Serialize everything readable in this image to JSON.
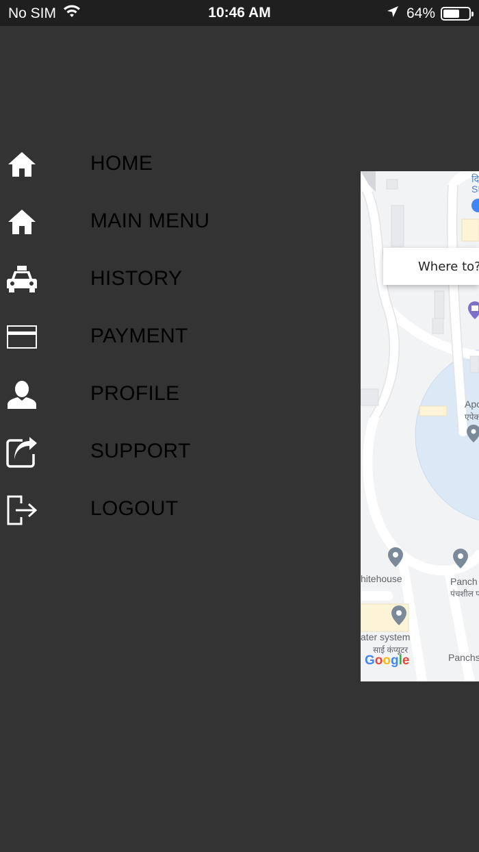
{
  "status_bar": {
    "carrier": "No SIM",
    "time": "10:46 AM",
    "battery_percent_label": "64%",
    "battery_level": 0.64
  },
  "menu": {
    "items": [
      {
        "label": "HOME",
        "icon": "home-icon"
      },
      {
        "label": "MAIN MENU",
        "icon": "home-icon"
      },
      {
        "label": "HISTORY",
        "icon": "taxi-icon"
      },
      {
        "label": "PAYMENT",
        "icon": "card-icon"
      },
      {
        "label": "PROFILE",
        "icon": "user-icon"
      },
      {
        "label": "SUPPORT",
        "icon": "share-icon"
      },
      {
        "label": "LOGOUT",
        "icon": "logout-icon"
      }
    ]
  },
  "map": {
    "search_placeholder": "Where to?",
    "labels": {
      "top_right_a": "दि",
      "top_right_b": "SI",
      "ape": "Apo",
      "ape_hindi": "एपेक",
      "whitehouse": "hitehouse",
      "panch1": "Panch",
      "panch1_hindi": "पंचशील प",
      "ater_system": "ater system",
      "ater_hindi": "साई कंप्यूटर",
      "panch2": "Panchs"
    },
    "attribution": "Google"
  },
  "colors": {
    "background": "#333333",
    "status_bar": "#1f1f1f",
    "menu_text": "#000000",
    "map_bg": "#f2f3f5",
    "map_circle": "#dbe9f6",
    "pin": "#7a8a99"
  }
}
